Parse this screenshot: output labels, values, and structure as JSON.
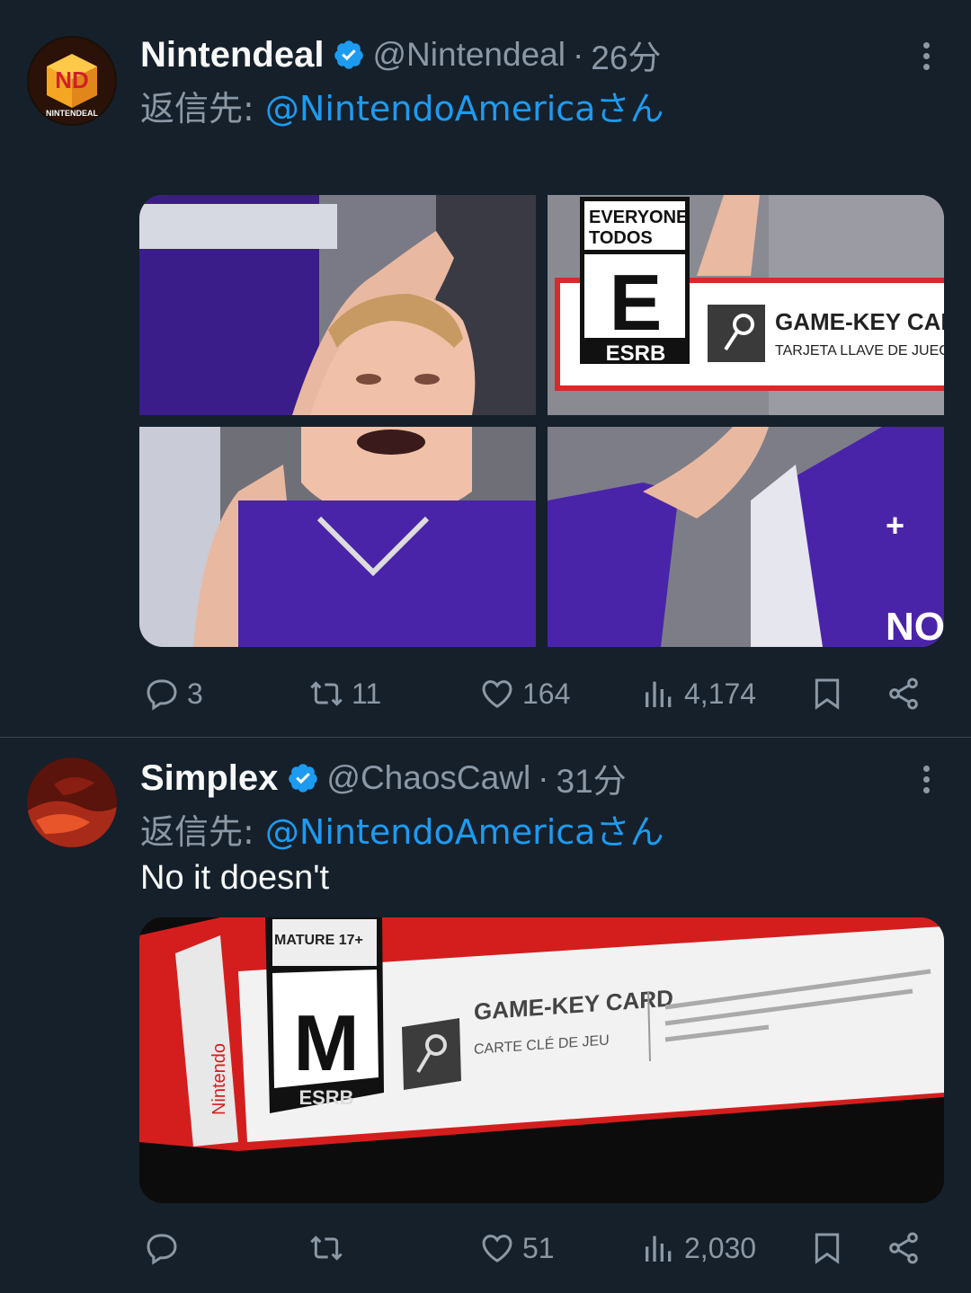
{
  "tweets": [
    {
      "name": "Nintendeal",
      "handle": "@Nintendeal",
      "separator": "·",
      "time": "26分",
      "reply_prefix": "返信先: ",
      "reply_to": "@NintendoAmericaさん",
      "avatar_text": "NINTENDEAL",
      "avatar_letters": "ND",
      "media_text": {
        "rating_top1": "EVERYONE",
        "rating_top2": "TODOS",
        "rating_letter": "E",
        "rating_org": "ESRB",
        "card_title": "GAME-KEY CARD",
        "card_subtitle": "TARJETA LLAVE DE JUEGO",
        "jersey_text": "NOR"
      },
      "stats": {
        "replies": "3",
        "retweets": "11",
        "likes": "164",
        "views": "4,174"
      }
    },
    {
      "name": "Simplex",
      "handle": "@ChaosCawl",
      "separator": "·",
      "time": "31分",
      "reply_prefix": "返信先: ",
      "reply_to": "@NintendoAmericaさん",
      "text": "No it doesn't",
      "media_text": {
        "rating_top": "MATURE 17+",
        "rating_letter": "M",
        "rating_org": "ESRB",
        "card_title": "GAME-KEY CARD",
        "card_subtitle": "CARTE CLÉ DE JEU",
        "side_brand": "Nintendo"
      },
      "stats": {
        "replies": "",
        "retweets": "",
        "likes": "51",
        "views": "2,030"
      }
    }
  ],
  "colors": {
    "background": "#15202b",
    "link": "#1d9bf0",
    "muted": "#8b98a5",
    "verified": "#1d9bf0"
  },
  "icons": [
    "reply-icon",
    "retweet-icon",
    "like-icon",
    "views-icon",
    "bookmark-icon",
    "share-icon",
    "more-icon",
    "verified-icon"
  ]
}
